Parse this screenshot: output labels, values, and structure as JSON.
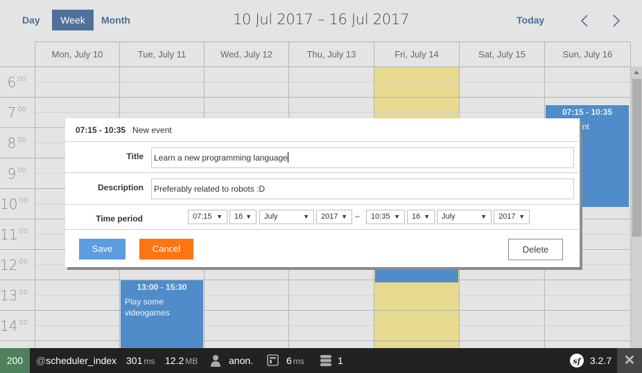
{
  "nav": {
    "day_label": "Day",
    "week_label": "Week",
    "month_label": "Month",
    "today_label": "Today",
    "active_view": "Week",
    "range_title": "10 Jul 2017 – 16 Jul 2017"
  },
  "days": [
    {
      "label": "Mon, July 10"
    },
    {
      "label": "Tue, July 11"
    },
    {
      "label": "Wed, July 12"
    },
    {
      "label": "Thu, July 13"
    },
    {
      "label": "Fri, July 14",
      "today": true
    },
    {
      "label": "Sat, July 15"
    },
    {
      "label": "Sun, July 16"
    }
  ],
  "hours": [
    {
      "h": "6",
      "m": "00"
    },
    {
      "h": "7",
      "m": "00"
    },
    {
      "h": "8",
      "m": "00"
    },
    {
      "h": "9",
      "m": "00"
    },
    {
      "h": "10",
      "m": "00"
    },
    {
      "h": "11",
      "m": "00"
    },
    {
      "h": "12",
      "m": "00"
    },
    {
      "h": "13",
      "m": "00"
    },
    {
      "h": "14",
      "m": "00"
    }
  ],
  "events": [
    {
      "day": "Sun, July 16",
      "time": "07:15 - 10:35",
      "text": "New event",
      "start": "07:15",
      "end": "10:35"
    },
    {
      "day": "Tue, July 11",
      "time": "13:00 - 15:30",
      "text": "Play some videogames",
      "start": "13:00",
      "end": "15:30"
    },
    {
      "day": "Fri, July 14",
      "time": "",
      "text": "",
      "start": "",
      "end": "12:40"
    }
  ],
  "dialog": {
    "header_time": "07:15 - 10:35",
    "header_text": "New event",
    "title_label": "Title",
    "title_value": "Learn a new programming language",
    "description_label": "Description",
    "description_value": "Preferably related to robots :D",
    "time_period_label": "Time period",
    "start": {
      "time": "07:15",
      "day": "16",
      "month": "July",
      "year": "2017"
    },
    "end": {
      "time": "10:35",
      "day": "16",
      "month": "July",
      "year": "2017"
    },
    "separator": "–",
    "save_label": "Save",
    "cancel_label": "Cancel",
    "delete_label": "Delete"
  },
  "toolbar": {
    "status": "200",
    "route_prefix": "@",
    "route": "scheduler_index",
    "time_value": "301",
    "time_unit": "ms",
    "memory_value": "12.2",
    "memory_unit": "MB",
    "user": "anon.",
    "render_value": "6",
    "render_unit": "ms",
    "db_queries": "1",
    "version": "3.2.7"
  },
  "colors": {
    "accent": "#4e709a",
    "event": "#4f8cc9",
    "today_column": "#e6da8e",
    "save": "#5c9ddf",
    "cancel": "#fb7510",
    "status_ok": "#4f805d"
  }
}
